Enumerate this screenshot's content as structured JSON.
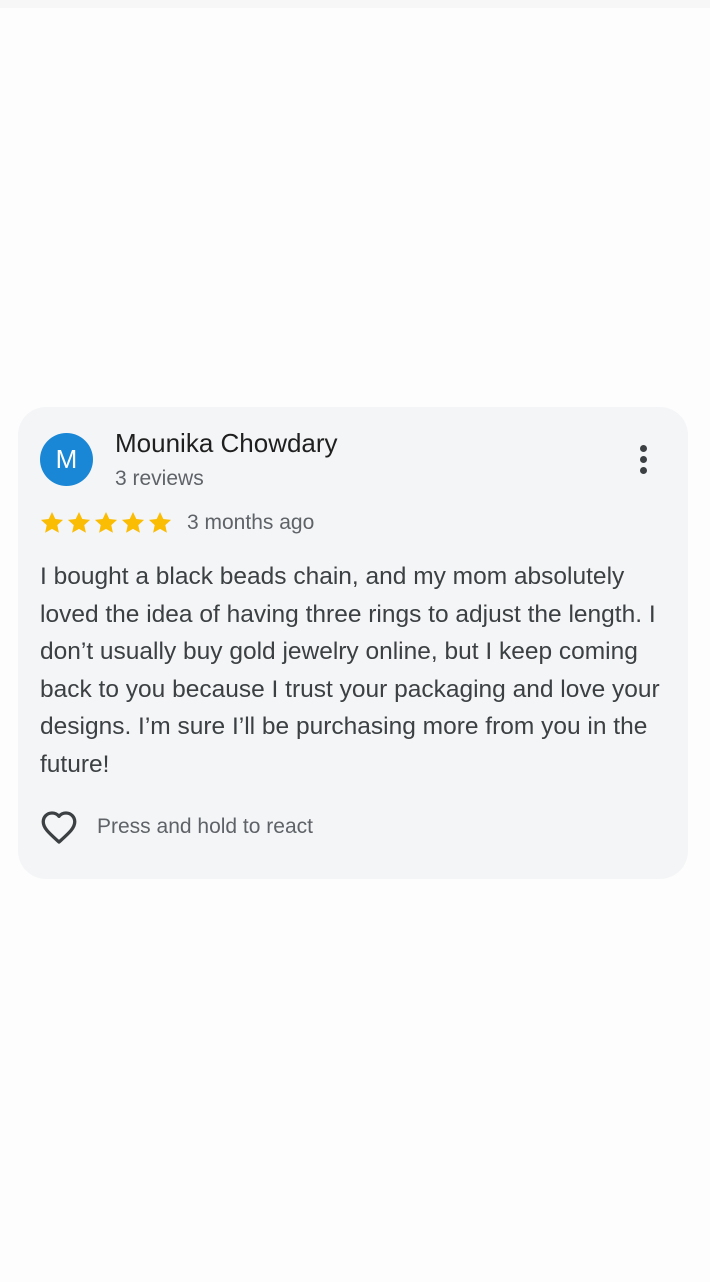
{
  "review": {
    "avatar_initial": "M",
    "reviewer_name": "Mounika Chowdary",
    "review_count": "3 reviews",
    "more_icon": "more-vert-icon",
    "rating": 5,
    "rating_max": 5,
    "timestamp": "3 months ago",
    "text": "I bought a black beads chain, and my mom absolutely loved the idea of having three rings to adjust the length. I don’t usually buy gold jewelry online, but I keep coming back to you because I trust your packaging and love your designs. I’m sure I’ll be purchasing more from you in the future!",
    "react_label": "Press and hold to react",
    "react_icon": "heart-outline-icon"
  },
  "colors": {
    "avatar_bg": "#1a87d6",
    "star": "#fbbc04",
    "card_bg": "#f4f5f7",
    "page_bg": "#fdfdfd"
  }
}
